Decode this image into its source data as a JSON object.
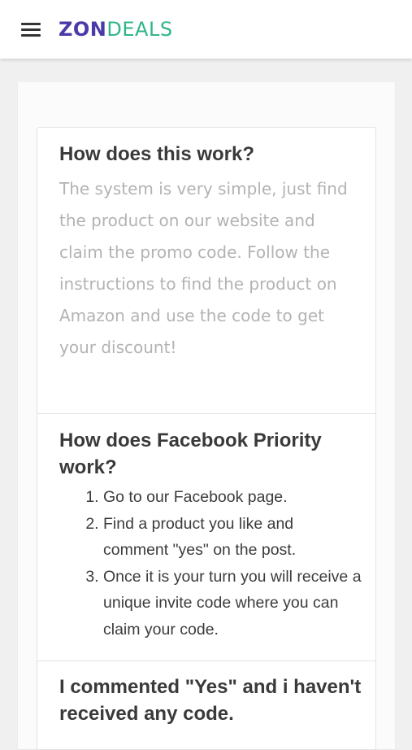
{
  "header": {
    "menu_icon": "hamburger-menu-icon",
    "logo_part1": "ZON",
    "logo_part2": "DEALS",
    "logo_colors": {
      "zon": "#4a3aa8",
      "deals": "#2fb58b"
    }
  },
  "faq": [
    {
      "question": "How does this work?",
      "answer": "The system is very simple, just find the product on our website and claim the promo code. Follow the instructions to find the product on Amazon and use the code to get your discount!"
    },
    {
      "question": "How does Facebook Priority work?",
      "steps": [
        "Go to our Facebook page.",
        "Find a product you like and comment \"yes\" on the post.",
        "Once it is your turn you will receive a unique invite code where you can claim your code."
      ]
    },
    {
      "question": "I commented \"Yes\" and i haven't received any code."
    }
  ]
}
